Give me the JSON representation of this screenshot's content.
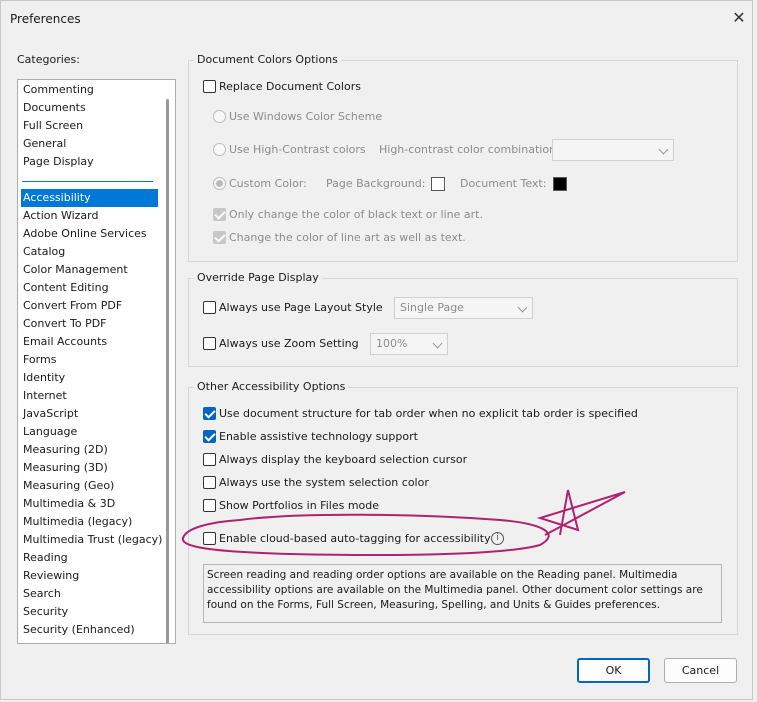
{
  "window": {
    "title": "Preferences",
    "close_label": "✕"
  },
  "categories": {
    "label": "Categories:",
    "top_items": [
      "Commenting",
      "Documents",
      "Full Screen",
      "General",
      "Page Display"
    ],
    "items": [
      "Accessibility",
      "Action Wizard",
      "Adobe Online Services",
      "Catalog",
      "Color Management",
      "Content Editing",
      "Convert From PDF",
      "Convert To PDF",
      "Email Accounts",
      "Forms",
      "Identity",
      "Internet",
      "JavaScript",
      "Language",
      "Measuring (2D)",
      "Measuring (3D)",
      "Measuring (Geo)",
      "Multimedia & 3D",
      "Multimedia (legacy)",
      "Multimedia Trust (legacy)",
      "Reading",
      "Reviewing",
      "Search",
      "Security",
      "Security (Enhanced)"
    ],
    "selected": "Accessibility"
  },
  "doc_colors": {
    "title": "Document Colors Options",
    "replace": {
      "label": "Replace Document Colors",
      "checked": false
    },
    "windows_scheme": "Use Windows Color Scheme",
    "high_contrast": "Use High-Contrast colors",
    "hc_combo_label": "High-contrast color combination:",
    "hc_combo_value": "",
    "custom": "Custom Color:",
    "page_bg_label": "Page Background:",
    "doc_text_label": "Document Text:",
    "page_bg_color": "#ffffff",
    "doc_text_color": "#000000",
    "only_black": "Only change the color of black text or line art.",
    "line_art": "Change the color of line art as well as text."
  },
  "override": {
    "title": "Override Page Display",
    "layout_label": "Always use Page Layout Style",
    "layout_value": "Single Page",
    "zoom_label": "Always use Zoom Setting",
    "zoom_value": "100%"
  },
  "other": {
    "title": "Other Accessibility Options",
    "opts": [
      {
        "label": "Use document structure for tab order when no explicit tab order is specified",
        "checked": true
      },
      {
        "label": "Enable assistive technology support",
        "checked": true
      },
      {
        "label": "Always display the keyboard selection cursor",
        "checked": false
      },
      {
        "label": "Always use the system selection color",
        "checked": false
      },
      {
        "label": "Show Portfolios in Files mode",
        "checked": false
      },
      {
        "label": "Enable cloud-based auto-tagging for accessibility",
        "checked": false
      }
    ],
    "info_glyph": "i"
  },
  "description": "Screen reading and reading order options are available on the Reading panel. Multimedia accessibility options are available on the Multimedia panel. Other document color settings are found on the Forms, Full Screen, Measuring, Spelling, and Units & Guides preferences.",
  "buttons": {
    "ok": "OK",
    "cancel": "Cancel"
  },
  "colors": {
    "accent": "#0078d7",
    "annotation": "#b0226e"
  }
}
